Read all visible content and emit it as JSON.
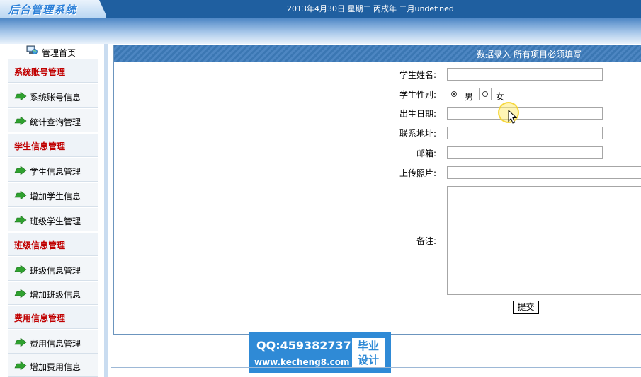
{
  "header": {
    "logo_text": "后台管理系统",
    "date_text": "2013年4月30日 星期二 丙戌年 二月undefined"
  },
  "sidebar": {
    "home_label": "管理首页",
    "sections": [
      {
        "title": "系统账号管理",
        "items": [
          "系统账号信息",
          "统计查询管理"
        ]
      },
      {
        "title": "学生信息管理",
        "items": [
          "学生信息管理",
          "增加学生信息",
          "班级学生管理"
        ]
      },
      {
        "title": "班级信息管理",
        "items": [
          "班级信息管理",
          "增加班级信息"
        ]
      },
      {
        "title": "费用信息管理",
        "items": [
          "费用信息管理",
          "增加费用信息"
        ]
      }
    ]
  },
  "form": {
    "title": "数据录入 所有项目必须填写",
    "name_label": "学生姓名:",
    "gender_label": "学生性别:",
    "gender_male": "男",
    "gender_female": "女",
    "gender_selected": "男",
    "birth_label": "出生日期:",
    "address_label": "联系地址:",
    "email_label": "邮箱:",
    "photo_label": "上传照片:",
    "remark_label": "备注:",
    "submit_label": "提交"
  },
  "watermark": {
    "qq": "QQ:459382737",
    "url": "www.kecheng8.com",
    "badge_line1": "毕业",
    "badge_line2": "设计"
  },
  "colors": {
    "topbar": "#1f5fa0",
    "section_title": "#c00000",
    "panel_header": "#3b77b3",
    "watermark": "#2f8ad6"
  },
  "icons": {
    "home": "computer-globe-icon",
    "item": "green-arrow-icon"
  }
}
